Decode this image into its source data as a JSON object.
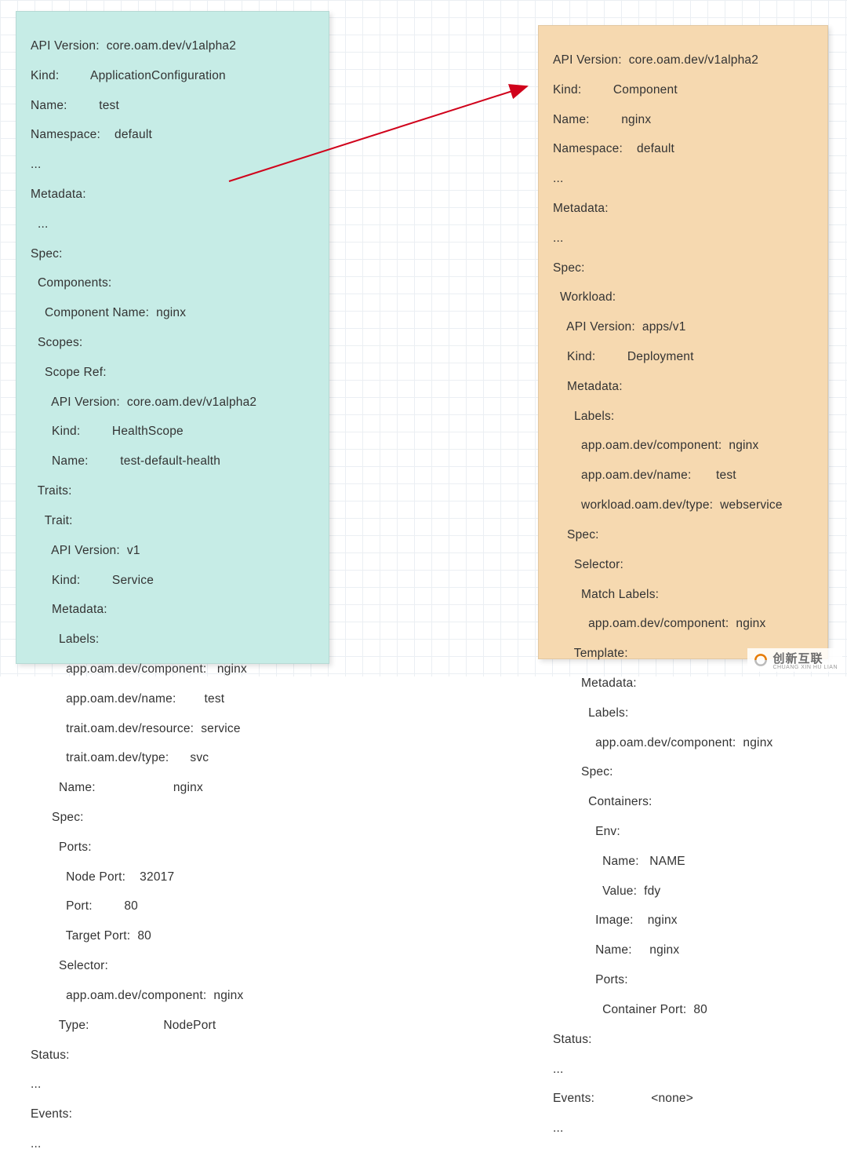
{
  "left": {
    "l0": "API Version:  core.oam.dev/v1alpha2",
    "l1": "Kind:         ApplicationConfiguration",
    "l2": "Name:         test",
    "l3": "Namespace:    default",
    "l4": "...",
    "l5": "Metadata:",
    "l6": "  ...",
    "l7": "Spec:",
    "l8": "  Components:",
    "l9": "    Component Name:  nginx",
    "l10": "  Scopes:",
    "l11": "    Scope Ref:",
    "l12": "      API Version:  core.oam.dev/v1alpha2",
    "l13": "      Kind:         HealthScope",
    "l14": "      Name:         test-default-health",
    "l15": "  Traits:",
    "l16": "    Trait:",
    "l17": "      API Version:  v1",
    "l18": "      Kind:         Service",
    "l19": "      Metadata:",
    "l20": "        Labels:",
    "l21": "          app.oam.dev/component:   nginx",
    "l22": "          app.oam.dev/name:        test",
    "l23": "          trait.oam.dev/resource:  service",
    "l24": "          trait.oam.dev/type:      svc",
    "l25": "        Name:                      nginx",
    "l26": "      Spec:",
    "l27": "        Ports:",
    "l28": "          Node Port:    32017",
    "l29": "          Port:         80",
    "l30": "          Target Port:  80",
    "l31": "        Selector:",
    "l32": "          app.oam.dev/component:  nginx",
    "l33": "        Type:                     NodePort",
    "l34": "Status:",
    "l35": "...",
    "l36": "Events:",
    "l37": "..."
  },
  "right": {
    "l0": "API Version:  core.oam.dev/v1alpha2",
    "l1": "Kind:         Component",
    "l2": "Name:         nginx",
    "l3": "Namespace:    default",
    "l4": "...",
    "l5": "Metadata:",
    "l6": "...",
    "l7": "Spec:",
    "l8": "  Workload:",
    "l9": "    API Version:  apps/v1",
    "l10": "    Kind:         Deployment",
    "l11": "    Metadata:",
    "l12": "      Labels:",
    "l13": "        app.oam.dev/component:  nginx",
    "l14": "        app.oam.dev/name:       test",
    "l15": "        workload.oam.dev/type:  webservice",
    "l16": "    Spec:",
    "l17": "      Selector:",
    "l18": "        Match Labels:",
    "l19": "          app.oam.dev/component:  nginx",
    "l20": "      Template:",
    "l21": "        Metadata:",
    "l22": "          Labels:",
    "l23": "            app.oam.dev/component:  nginx",
    "l24": "        Spec:",
    "l25": "          Containers:",
    "l26": "            Env:",
    "l27": "              Name:   NAME",
    "l28": "              Value:  fdy",
    "l29": "            Image:    nginx",
    "l30": "            Name:     nginx",
    "l31": "            Ports:",
    "l32": "              Container Port:  80",
    "l33": "Status:",
    "l34": "...",
    "l35": "Events:                <none>",
    "l36": "..."
  },
  "watermark": {
    "main": "创新互联",
    "sub": "CHUANG XIN HU LIAN"
  }
}
